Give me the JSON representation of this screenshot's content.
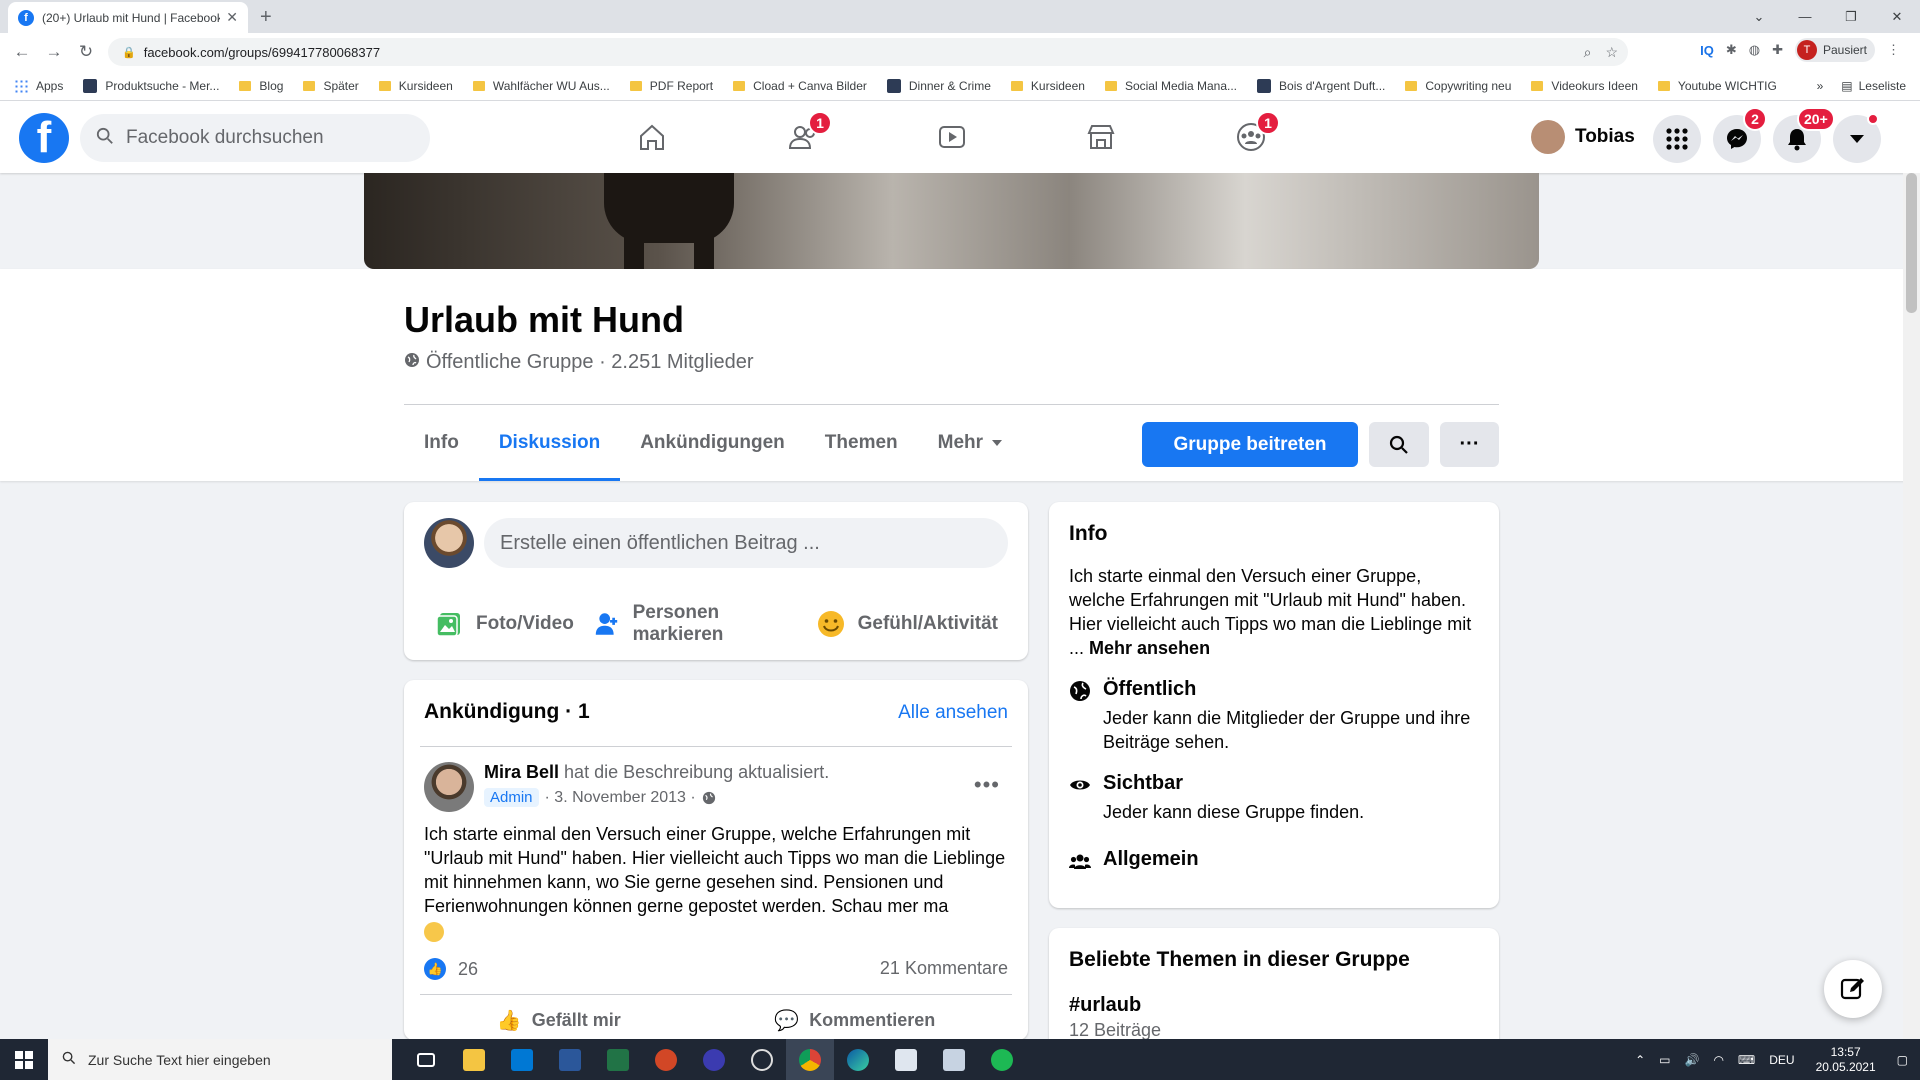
{
  "browser": {
    "tab_title": "(20+) Urlaub mit Hund | Facebook",
    "url": "facebook.com/groups/699417780068377",
    "profile_status": "Pausiert",
    "profile_initial": "T",
    "bookmarks": [
      {
        "label": "Apps",
        "type": "apps"
      },
      {
        "label": "Produktsuche - Mer...",
        "type": "site"
      },
      {
        "label": "Blog",
        "type": "folder"
      },
      {
        "label": "Später",
        "type": "folder"
      },
      {
        "label": "Kursideen",
        "type": "folder"
      },
      {
        "label": "Wahlfächer WU Aus...",
        "type": "folder"
      },
      {
        "label": "PDF Report",
        "type": "folder"
      },
      {
        "label": "Cload + Canva Bilder",
        "type": "folder"
      },
      {
        "label": "Dinner & Crime",
        "type": "site"
      },
      {
        "label": "Kursideen",
        "type": "folder"
      },
      {
        "label": "Social Media Mana...",
        "type": "folder"
      },
      {
        "label": "Bois d'Argent Duft...",
        "type": "site"
      },
      {
        "label": "Copywriting neu",
        "type": "folder"
      },
      {
        "label": "Videokurs Ideen",
        "type": "folder"
      },
      {
        "label": "Youtube WICHTIG",
        "type": "folder"
      }
    ],
    "reading_list": "Leseliste",
    "overflow": "»"
  },
  "fb_header": {
    "search_placeholder": "Facebook durchsuchen",
    "friends_badge": "1",
    "groups_badge": "1",
    "user_name": "Tobias",
    "messenger_badge": "2",
    "notifications_badge": "20+"
  },
  "group": {
    "name": "Urlaub mit Hund",
    "meta": "Öffentliche Gruppe · 2.251 Mitglieder",
    "tabs": [
      {
        "label": "Info",
        "active": false
      },
      {
        "label": "Diskussion",
        "active": true
      },
      {
        "label": "Ankündigungen",
        "active": false
      },
      {
        "label": "Themen",
        "active": false
      },
      {
        "label": "Mehr",
        "active": false
      }
    ],
    "join_label": "Gruppe beitreten",
    "more_label": "···"
  },
  "composer": {
    "placeholder": "Erstelle einen öffentlichen Beitrag ...",
    "actions": [
      "Foto/Video",
      "Personen markieren",
      "Gefühl/Aktivität"
    ]
  },
  "announcement": {
    "title": "Ankündigung · 1",
    "see_all": "Alle ansehen",
    "author": "Mira Bell",
    "action": "hat die Beschreibung aktualisiert.",
    "role": "Admin",
    "date": "· 3. November 2013 ·",
    "text": "Ich starte einmal den Versuch einer Gruppe, welche Erfahrungen mit \"Urlaub mit Hund\" haben. Hier vielleicht auch Tipps wo man die Lieblinge mit hinnehmen kann, wo Sie gerne gesehen sind. Pensionen und Ferienwohnungen können gerne gepostet werden. Schau mer ma",
    "likes": "26",
    "comments": "21 Kommentare",
    "like_label": "Gefällt mir",
    "comment_label": "Kommentieren"
  },
  "info": {
    "title": "Info",
    "description": "Ich starte einmal den Versuch einer Gruppe, welche Erfahrungen mit \"Urlaub mit Hund\" haben. Hier vielleicht auch Tipps wo man die Lieblinge mit ...",
    "see_more": "Mehr ansehen",
    "items": [
      {
        "title": "Öffentlich",
        "sub": "Jeder kann die Mitglieder der Gruppe und ihre Beiträge sehen."
      },
      {
        "title": "Sichtbar",
        "sub": "Jeder kann diese Gruppe finden."
      },
      {
        "title": "Allgemein",
        "sub": ""
      }
    ]
  },
  "themes": {
    "title": "Beliebte Themen in dieser Gruppe",
    "tag": "#urlaub",
    "count": "12 Beiträge"
  },
  "taskbar": {
    "search_placeholder": "Zur Suche Text hier eingeben",
    "language": "DEU",
    "time": "13:57",
    "date": "20.05.2021"
  }
}
